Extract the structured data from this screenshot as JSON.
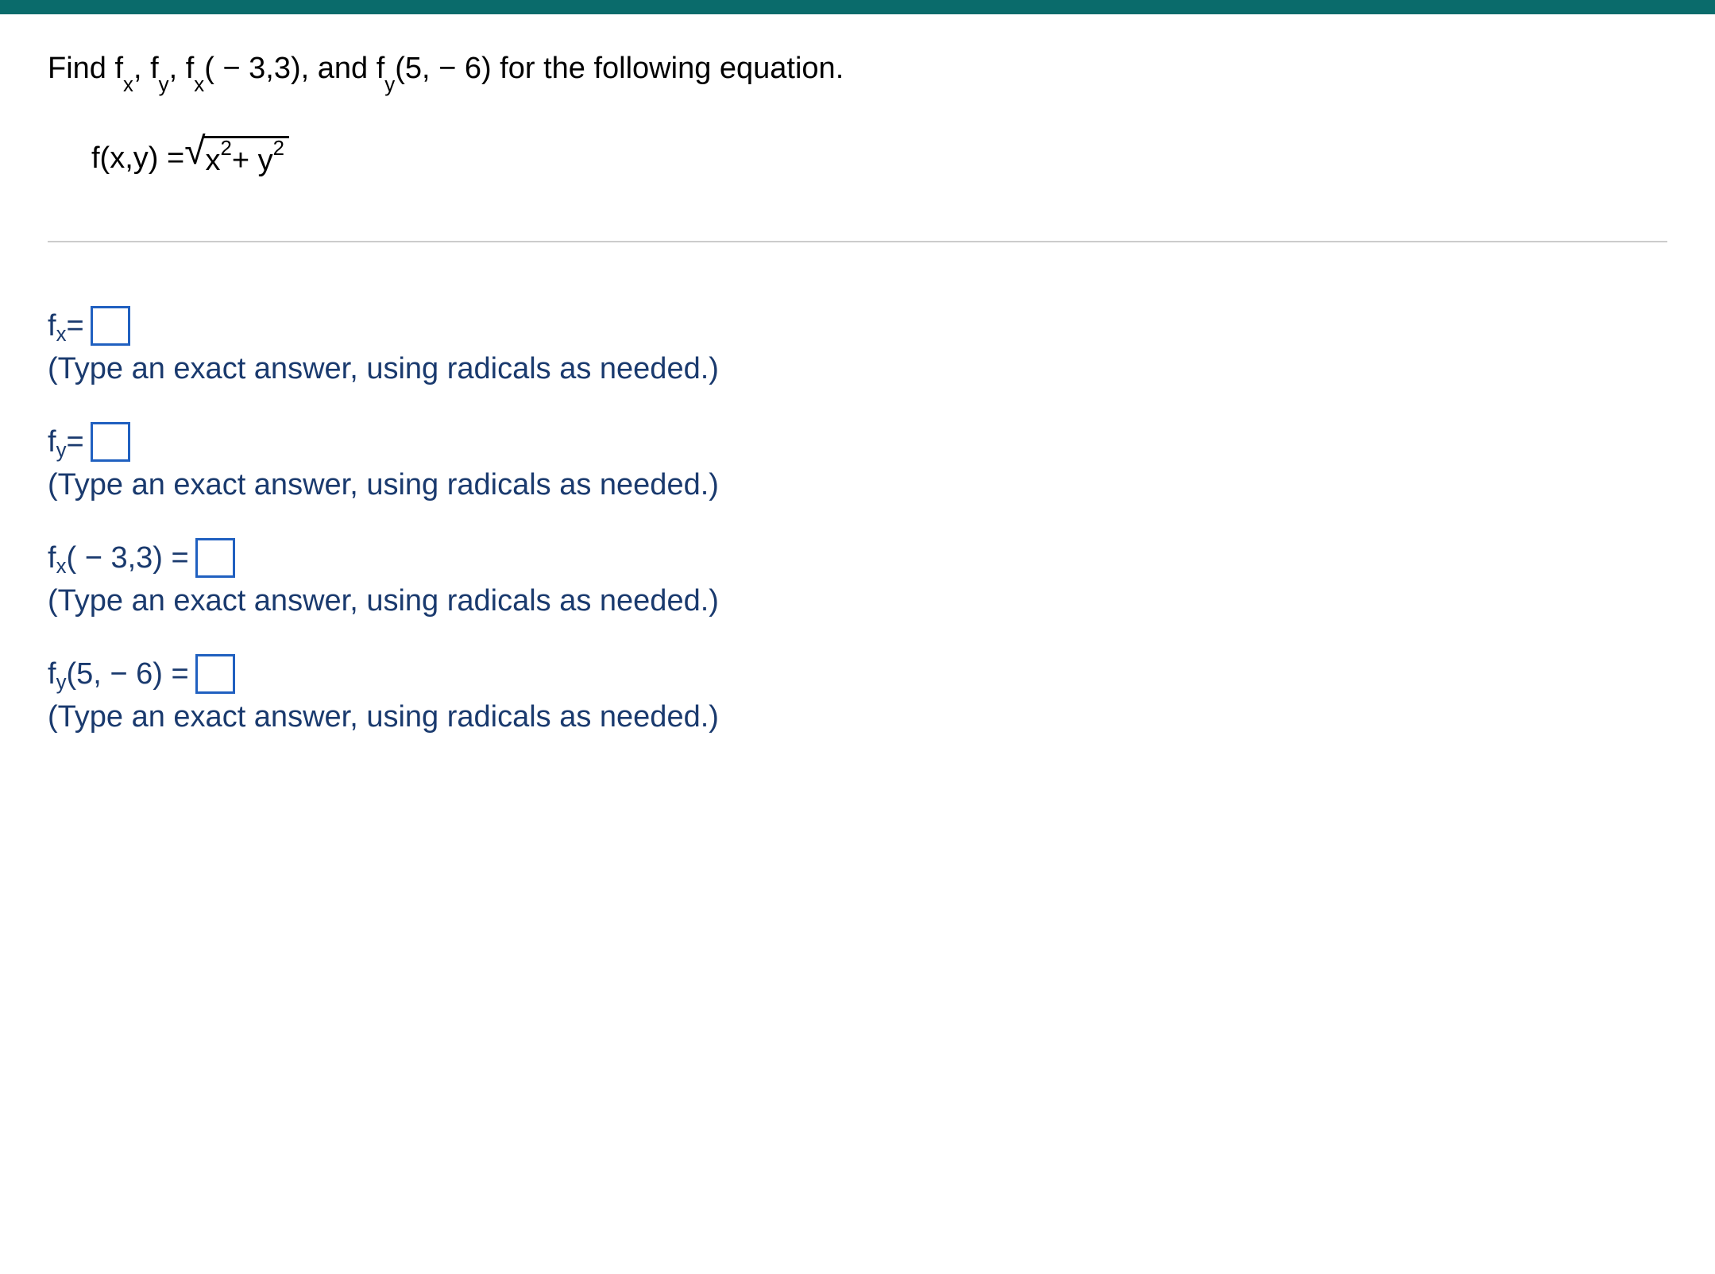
{
  "question": {
    "prefix": "Find f",
    "sub1": "x",
    "comma1": ", f",
    "sub2": "y",
    "comma2": ", f",
    "sub3": "x",
    "point1": "( − 3,3), and f",
    "sub4": "y",
    "point2": "(5, − 6) for the following equation."
  },
  "equation": {
    "lhs": "f(x,y) = ",
    "x": "x",
    "x_exp": "2",
    "plus": " + y",
    "y_exp": "2"
  },
  "answers": {
    "a1": {
      "f": "f",
      "sub": "x",
      "eq": " = ",
      "hint": "(Type an exact answer, using radicals as needed.)"
    },
    "a2": {
      "f": "f",
      "sub": "y",
      "eq": " = ",
      "hint": "(Type an exact answer, using radicals as needed.)"
    },
    "a3": {
      "f": "f",
      "sub": "x",
      "args": "( − 3,3) = ",
      "hint": "(Type an exact answer, using radicals as needed.)"
    },
    "a4": {
      "f": "f",
      "sub": "y",
      "args": "(5, − 6) = ",
      "hint": "(Type an exact answer, using radicals as needed.)"
    }
  }
}
